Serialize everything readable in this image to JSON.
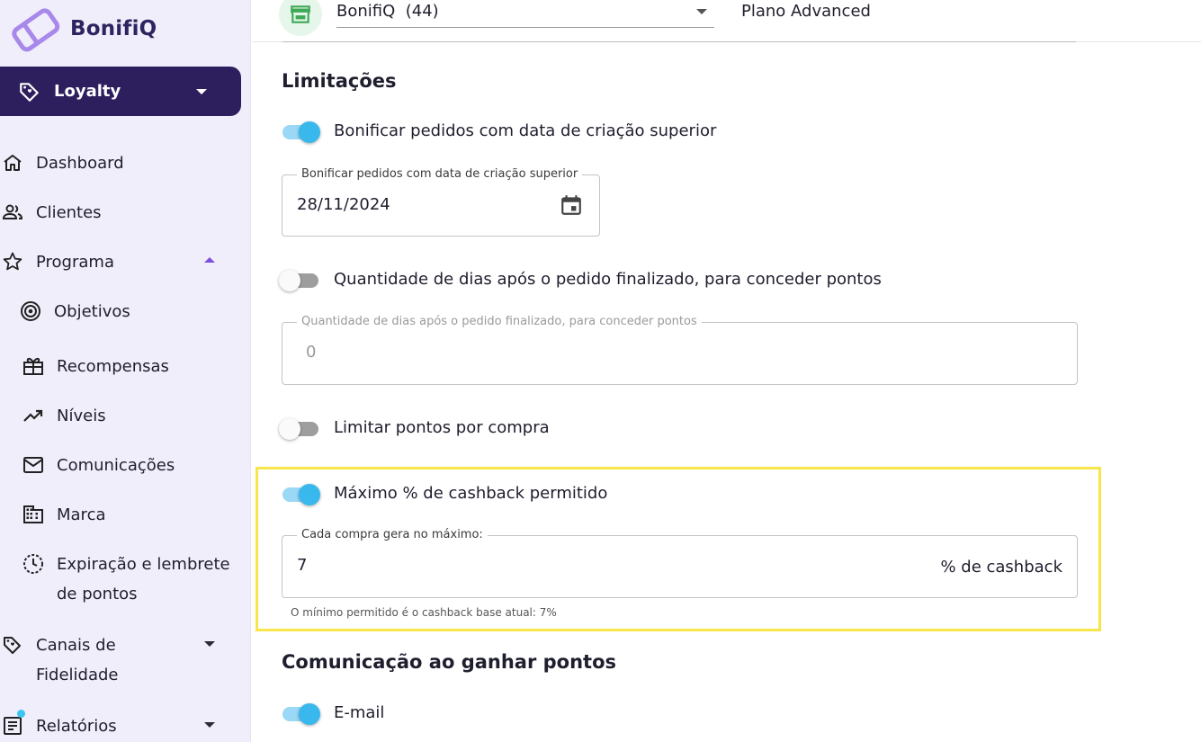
{
  "brand": {
    "name": "BonifiQ"
  },
  "sidebar": {
    "module": "Loyalty",
    "items": [
      {
        "label": "Dashboard",
        "icon": "home-icon"
      },
      {
        "label": "Clientes",
        "icon": "people-icon"
      },
      {
        "label": "Programa",
        "icon": "star-icon",
        "expanded": true
      },
      {
        "label": "Objetivos",
        "icon": "target-icon"
      },
      {
        "label": "Recompensas",
        "icon": "gift-icon"
      },
      {
        "label": "Níveis",
        "icon": "trending-icon"
      },
      {
        "label": "Comunicações",
        "icon": "mail-icon"
      },
      {
        "label": "Marca",
        "icon": "building-icon"
      },
      {
        "label_line1": "Expiração e lembrete",
        "label_line2": "de pontos",
        "icon": "clock-icon"
      },
      {
        "label_line1": "Canais de",
        "label_line2": "Fidelidade",
        "icon": "tag-icon"
      },
      {
        "label": "Relatórios",
        "icon": "report-icon"
      }
    ]
  },
  "header": {
    "store": "BonifiQ  (44)",
    "plan": "Plano Advanced"
  },
  "limits": {
    "title": "Limitações",
    "order_date": {
      "toggle_label": "Bonificar pedidos com data de criação superior",
      "enabled": true,
      "field_label": "Bonificar pedidos com data de criação superior",
      "value": "28/11/2024"
    },
    "days_after": {
      "toggle_label": "Quantidade de dias após o pedido finalizado, para conceder pontos",
      "enabled": false,
      "field_label": "Quantidade de dias após o pedido finalizado, para conceder pontos",
      "value": "0"
    },
    "points_per_purchase": {
      "toggle_label": "Limitar pontos por compra",
      "enabled": false
    },
    "max_cashback": {
      "toggle_label": "Máximo % de cashback permitido",
      "enabled": true,
      "field_label": "Cada compra gera no máximo:",
      "value": "7",
      "suffix": "% de cashback",
      "hint": "O mínimo permitido é o cashback base atual: 7%"
    }
  },
  "communication": {
    "title": "Comunicação ao ganhar pontos",
    "email": {
      "toggle_label": "E-mail",
      "enabled": true
    }
  },
  "colors": {
    "sidebar_bg": "#f1eefb",
    "module_bg": "#2d1f5e",
    "toggle_on": "#39b8ee",
    "highlight": "#f7e64a"
  }
}
